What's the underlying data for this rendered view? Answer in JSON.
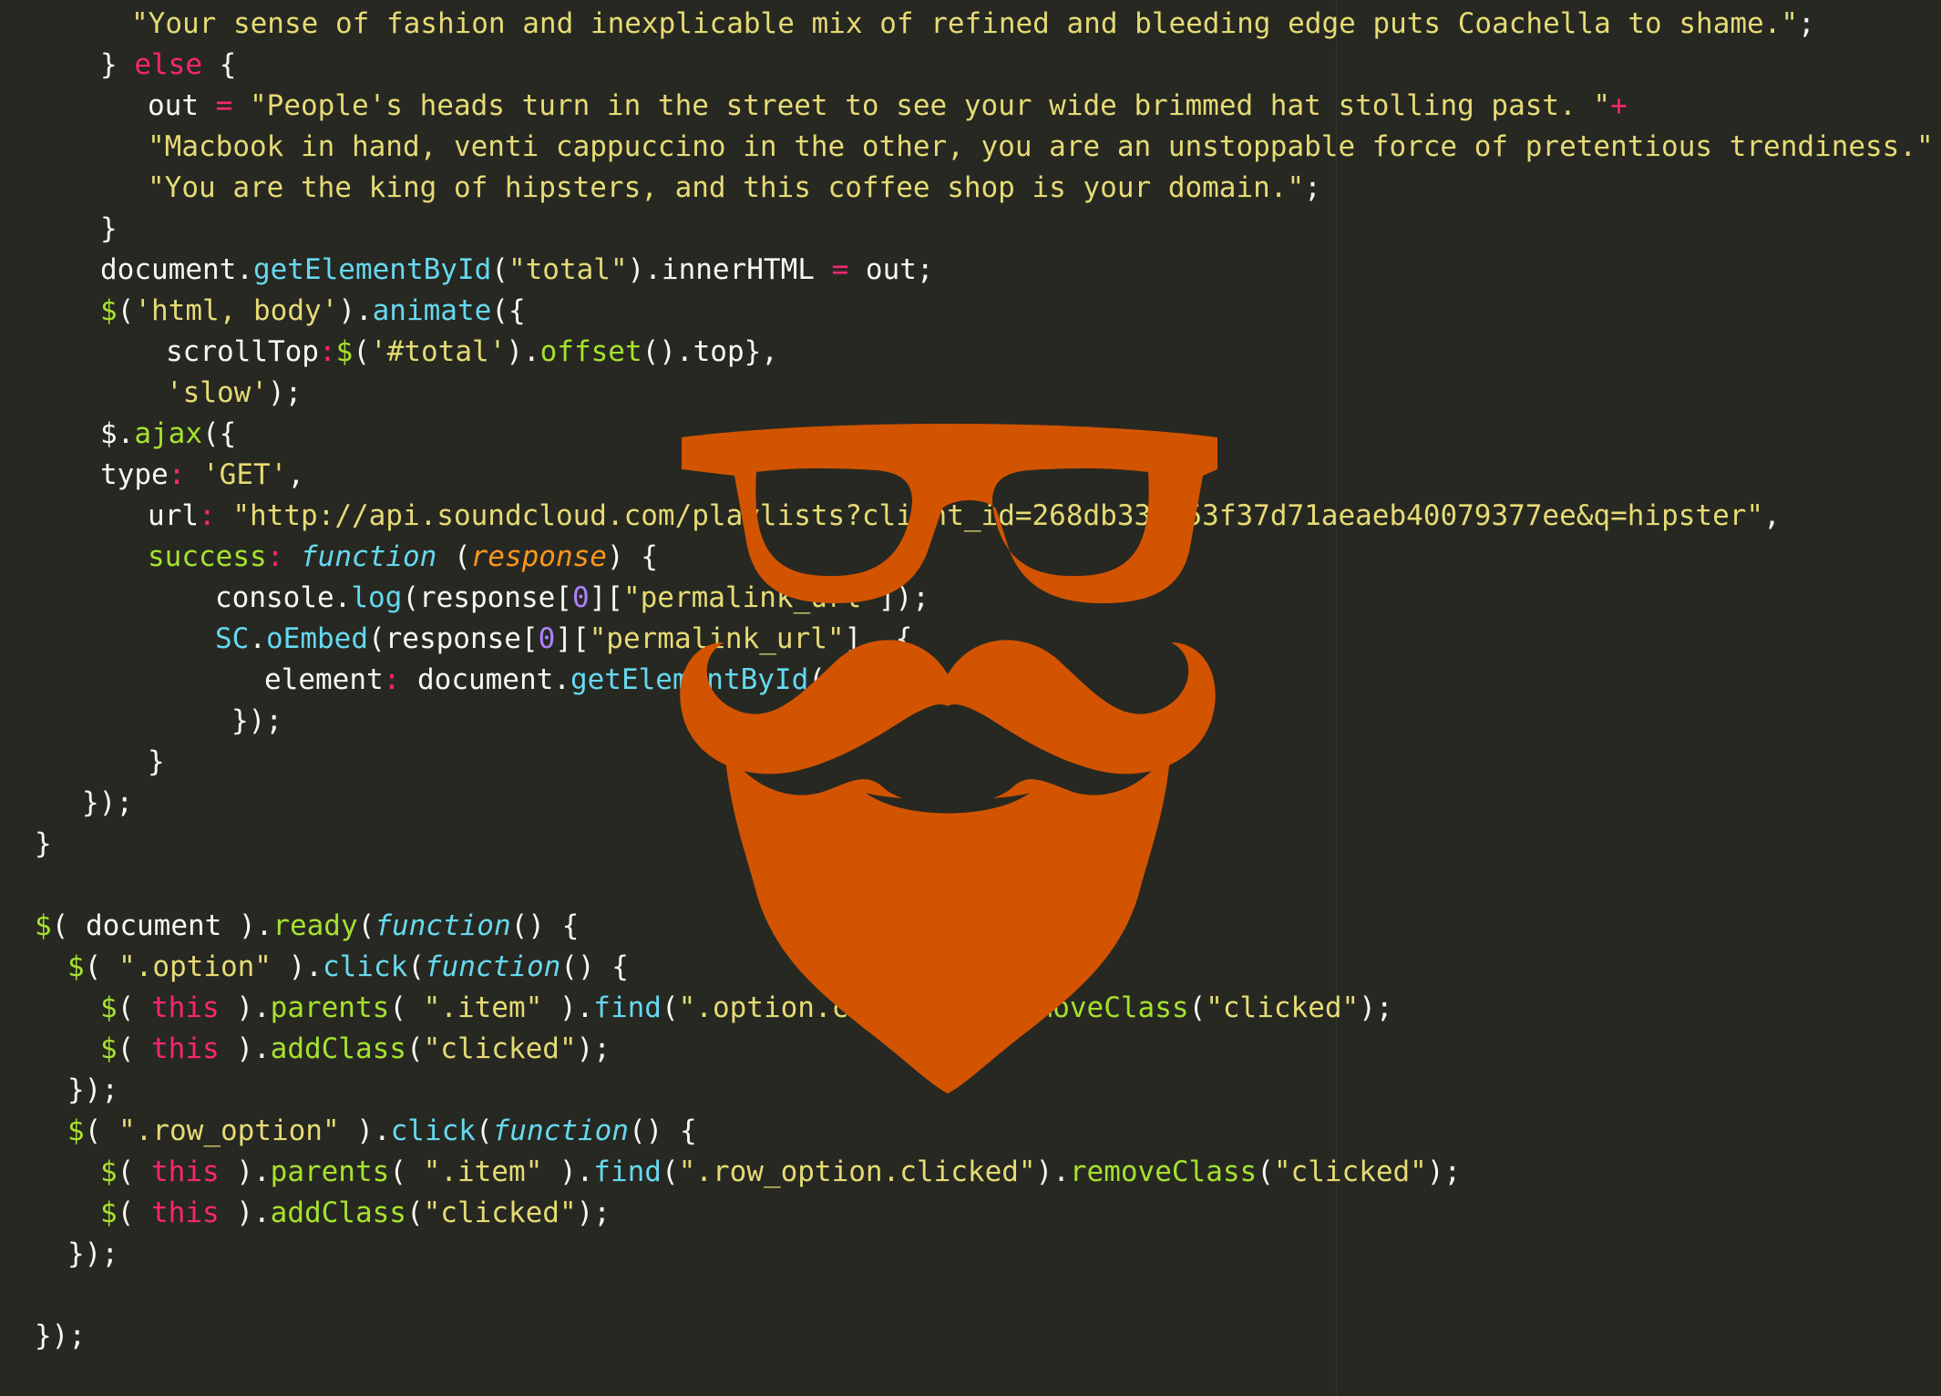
{
  "editor": {
    "theme_colors": {
      "background": "#272822",
      "text": "#F8F8F2",
      "string": "#E6DB74",
      "keyword": "#F92672",
      "function": "#66D9EF",
      "call": "#A6E22E",
      "parameter": "#FD971F",
      "number": "#AE81FF"
    },
    "lines": [
      [
        {
          "t": "\"Your sense of fashion and inexplicable mix of refined and bleeding edge puts Coachella to shame.\"",
          "c": "str"
        },
        {
          "t": ";",
          "c": "text"
        }
      ],
      [
        {
          "t": "} ",
          "c": "text"
        },
        {
          "t": "else",
          "c": "kw"
        },
        {
          "t": " {",
          "c": "text"
        }
      ],
      [
        {
          "t": "out ",
          "c": "text"
        },
        {
          "t": "=",
          "c": "op"
        },
        {
          "t": " \"People's heads turn in the street to see your wide brimmed hat stolling past. \"",
          "c": "str"
        },
        {
          "t": "+",
          "c": "op"
        }
      ],
      [
        {
          "t": "\"Macbook in hand, venti cappuccino in the other, you are an unstoppable force of pretentious trendiness.\"",
          "c": "str"
        },
        {
          "t": " +",
          "c": "op"
        }
      ],
      [
        {
          "t": "\"You are the king of hipsters, and this coffee shop is your domain.\"",
          "c": "str"
        },
        {
          "t": ";",
          "c": "text"
        }
      ],
      [
        {
          "t": "}",
          "c": "text"
        }
      ],
      [
        {
          "t": "document.",
          "c": "text"
        },
        {
          "t": "getElementById",
          "c": "fn"
        },
        {
          "t": "(",
          "c": "text"
        },
        {
          "t": "\"total\"",
          "c": "str"
        },
        {
          "t": ").innerHTML ",
          "c": "text"
        },
        {
          "t": "=",
          "c": "op"
        },
        {
          "t": " out;",
          "c": "text"
        }
      ],
      [
        {
          "t": "$",
          "c": "call"
        },
        {
          "t": "(",
          "c": "text"
        },
        {
          "t": "'html, body'",
          "c": "str"
        },
        {
          "t": ").",
          "c": "text"
        },
        {
          "t": "animate",
          "c": "fn"
        },
        {
          "t": "({",
          "c": "text"
        }
      ],
      [
        {
          "t": "scrollTop",
          "c": "text"
        },
        {
          "t": ":",
          "c": "op"
        },
        {
          "t": "$",
          "c": "call"
        },
        {
          "t": "(",
          "c": "text"
        },
        {
          "t": "'#total'",
          "c": "str"
        },
        {
          "t": ").",
          "c": "text"
        },
        {
          "t": "offset",
          "c": "call"
        },
        {
          "t": "().top},",
          "c": "text"
        }
      ],
      [
        {
          "t": "'slow'",
          "c": "str"
        },
        {
          "t": ");",
          "c": "text"
        }
      ],
      [
        {
          "t": "$.",
          "c": "text"
        },
        {
          "t": "ajax",
          "c": "call"
        },
        {
          "t": "({",
          "c": "text"
        }
      ],
      [
        {
          "t": "type",
          "c": "text"
        },
        {
          "t": ":",
          "c": "op"
        },
        {
          "t": " 'GET'",
          "c": "str"
        },
        {
          "t": ",",
          "c": "text"
        }
      ],
      [
        {
          "t": "url",
          "c": "text"
        },
        {
          "t": ":",
          "c": "op"
        },
        {
          "t": " \"http://api.soundcloud.com/playlists?client_id=268db33ab53f37d71aeaeb40079377ee&q=hipster\"",
          "c": "str"
        },
        {
          "t": ",",
          "c": "text"
        }
      ],
      [
        {
          "t": "success",
          "c": "prop"
        },
        {
          "t": ":",
          "c": "op"
        },
        {
          "t": " ",
          "c": "text"
        },
        {
          "t": "function",
          "c": "italic"
        },
        {
          "t": " (",
          "c": "text"
        },
        {
          "t": "response",
          "c": "param"
        },
        {
          "t": ") {",
          "c": "text"
        }
      ],
      [
        {
          "t": "console.",
          "c": "text"
        },
        {
          "t": "log",
          "c": "fn"
        },
        {
          "t": "(response[",
          "c": "text"
        },
        {
          "t": "0",
          "c": "num"
        },
        {
          "t": "][",
          "c": "text"
        },
        {
          "t": "\"permalink_url\"",
          "c": "str"
        },
        {
          "t": "]);",
          "c": "text"
        }
      ],
      [
        {
          "t": "SC",
          "c": "fn"
        },
        {
          "t": ".",
          "c": "text"
        },
        {
          "t": "oEmbed",
          "c": "fn"
        },
        {
          "t": "(response[",
          "c": "text"
        },
        {
          "t": "0",
          "c": "num"
        },
        {
          "t": "][",
          "c": "text"
        },
        {
          "t": "\"permalink_url\"",
          "c": "str"
        },
        {
          "t": "], {",
          "c": "text"
        }
      ],
      [
        {
          "t": "element",
          "c": "text"
        },
        {
          "t": ":",
          "c": "op"
        },
        {
          "t": " document.",
          "c": "text"
        },
        {
          "t": "getElementById",
          "c": "fn"
        },
        {
          "t": "(",
          "c": "text"
        }
      ],
      [
        {
          "t": "});",
          "c": "text"
        }
      ],
      [
        {
          "t": "}",
          "c": "text"
        }
      ],
      [
        {
          "t": "});",
          "c": "text"
        }
      ],
      [
        {
          "t": "}",
          "c": "text"
        }
      ],
      [],
      [
        {
          "t": "$",
          "c": "call"
        },
        {
          "t": "( document ).",
          "c": "text"
        },
        {
          "t": "ready",
          "c": "call"
        },
        {
          "t": "(",
          "c": "text"
        },
        {
          "t": "function",
          "c": "italic"
        },
        {
          "t": "() {",
          "c": "text"
        }
      ],
      [
        {
          "t": "$",
          "c": "call"
        },
        {
          "t": "( ",
          "c": "text"
        },
        {
          "t": "\".option\"",
          "c": "str"
        },
        {
          "t": " ).",
          "c": "text"
        },
        {
          "t": "click",
          "c": "fn"
        },
        {
          "t": "(",
          "c": "text"
        },
        {
          "t": "function",
          "c": "italic"
        },
        {
          "t": "() {",
          "c": "text"
        }
      ],
      [
        {
          "t": "$",
          "c": "call"
        },
        {
          "t": "( ",
          "c": "text"
        },
        {
          "t": "this",
          "c": "kw"
        },
        {
          "t": " ).",
          "c": "text"
        },
        {
          "t": "parents",
          "c": "call"
        },
        {
          "t": "( ",
          "c": "text"
        },
        {
          "t": "\".item\"",
          "c": "str"
        },
        {
          "t": " ).",
          "c": "text"
        },
        {
          "t": "find",
          "c": "fn"
        },
        {
          "t": "(",
          "c": "text"
        },
        {
          "t": "\".option.clicked\"",
          "c": "str"
        },
        {
          "t": ").",
          "c": "text"
        },
        {
          "t": "removeClass",
          "c": "call"
        },
        {
          "t": "(",
          "c": "text"
        },
        {
          "t": "\"clicked\"",
          "c": "str"
        },
        {
          "t": ");",
          "c": "text"
        }
      ],
      [
        {
          "t": "$",
          "c": "call"
        },
        {
          "t": "( ",
          "c": "text"
        },
        {
          "t": "this",
          "c": "kw"
        },
        {
          "t": " ).",
          "c": "text"
        },
        {
          "t": "addClass",
          "c": "call"
        },
        {
          "t": "(",
          "c": "text"
        },
        {
          "t": "\"clicked\"",
          "c": "str"
        },
        {
          "t": ");",
          "c": "text"
        }
      ],
      [
        {
          "t": "});",
          "c": "text"
        }
      ],
      [
        {
          "t": "$",
          "c": "call"
        },
        {
          "t": "( ",
          "c": "text"
        },
        {
          "t": "\".row_option\"",
          "c": "str"
        },
        {
          "t": " ).",
          "c": "text"
        },
        {
          "t": "click",
          "c": "fn"
        },
        {
          "t": "(",
          "c": "text"
        },
        {
          "t": "function",
          "c": "italic"
        },
        {
          "t": "() {",
          "c": "text"
        }
      ],
      [
        {
          "t": "$",
          "c": "call"
        },
        {
          "t": "( ",
          "c": "text"
        },
        {
          "t": "this",
          "c": "kw"
        },
        {
          "t": " ).",
          "c": "text"
        },
        {
          "t": "parents",
          "c": "call"
        },
        {
          "t": "( ",
          "c": "text"
        },
        {
          "t": "\".item\"",
          "c": "str"
        },
        {
          "t": " ).",
          "c": "text"
        },
        {
          "t": "find",
          "c": "fn"
        },
        {
          "t": "(",
          "c": "text"
        },
        {
          "t": "\".row_option.clicked\"",
          "c": "str"
        },
        {
          "t": ").",
          "c": "text"
        },
        {
          "t": "removeClass",
          "c": "call"
        },
        {
          "t": "(",
          "c": "text"
        },
        {
          "t": "\"clicked\"",
          "c": "str"
        },
        {
          "t": ");",
          "c": "text"
        }
      ],
      [
        {
          "t": "$",
          "c": "call"
        },
        {
          "t": "( ",
          "c": "text"
        },
        {
          "t": "this",
          "c": "kw"
        },
        {
          "t": " ).",
          "c": "text"
        },
        {
          "t": "addClass",
          "c": "call"
        },
        {
          "t": "(",
          "c": "text"
        },
        {
          "t": "\"clicked\"",
          "c": "str"
        },
        {
          "t": ");",
          "c": "text"
        }
      ],
      [
        {
          "t": "});",
          "c": "text"
        }
      ],
      [],
      [
        {
          "t": "});",
          "c": "text"
        }
      ]
    ]
  },
  "overlay": {
    "icon": "hipster-glasses-mustache-beard-icon",
    "color": "#D35400"
  }
}
